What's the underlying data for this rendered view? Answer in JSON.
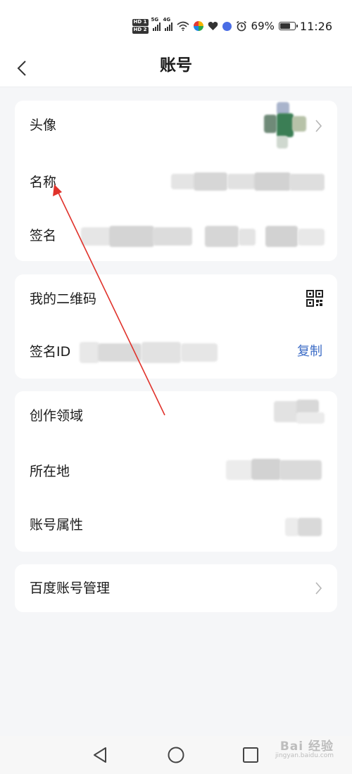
{
  "status_bar": {
    "hd1": "HD 1",
    "hd2": "HD 2",
    "net1": "5G",
    "net2": "4G",
    "battery_percent": "69%",
    "battery_level": 0.69,
    "time": "11:26"
  },
  "header": {
    "title": "账号",
    "back_icon": "chevron-left-icon"
  },
  "profile_card": {
    "avatar_label": "头像",
    "name_label": "名称",
    "signature_label": "签名"
  },
  "qr_card": {
    "qr_label": "我的二维码",
    "qr_icon": "qr-code-icon",
    "sign_id_label": "签名ID",
    "copy_label": "复制"
  },
  "info_card": {
    "domain_label": "创作领域",
    "location_label": "所在地",
    "account_type_label": "账号属性"
  },
  "manage_card": {
    "manage_label": "百度账号管理"
  },
  "colors": {
    "link": "#3c6cc6",
    "annotation_arrow": "#e0322b",
    "background": "#f5f6f8"
  },
  "watermark": {
    "brand": "Bai 经验",
    "url": "jingyan.baidu.com"
  }
}
